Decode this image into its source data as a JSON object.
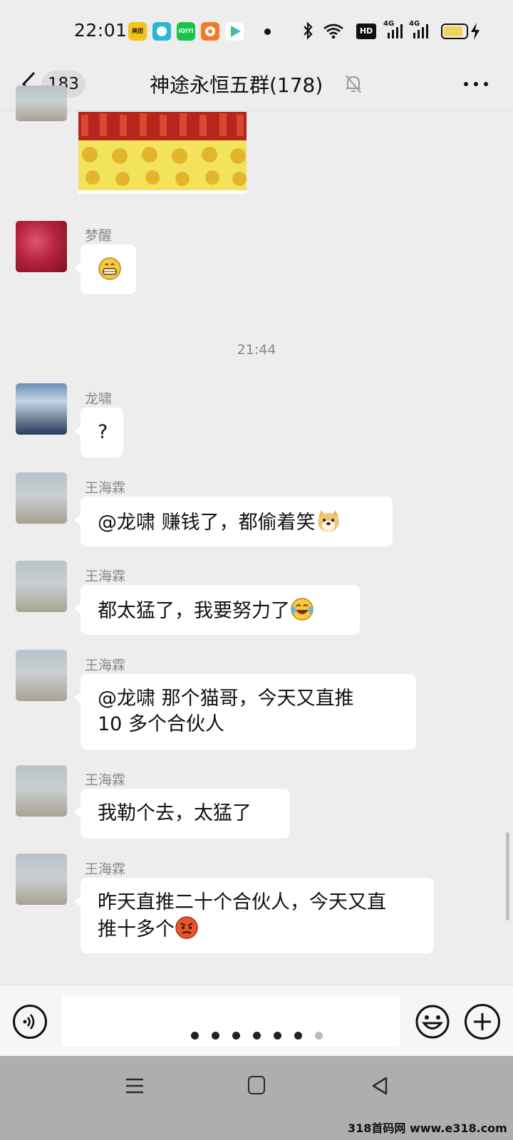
{
  "status_bar": {
    "time": "22:01",
    "apps": [
      {
        "name": "meituan-app-icon",
        "label": "美团",
        "color": "#f6c21a"
      },
      {
        "name": "app2-icon",
        "label": "",
        "color": "#2ab5d4"
      },
      {
        "name": "iqiyi-app-icon",
        "label": "iQIYI",
        "color": "#19c24a"
      },
      {
        "name": "app4-icon",
        "label": "",
        "color": "#f47a2a"
      },
      {
        "name": "app5-icon",
        "label": "",
        "color": "#3fb6e8"
      }
    ],
    "hd_label": "HD",
    "signal1_label": "4G",
    "signal2_label": "4G"
  },
  "header": {
    "unread_count": "183",
    "title": "神途永恒五群(178)"
  },
  "messages": [
    {
      "sender": "梦醒",
      "text": ""
    },
    {
      "sender": "龙啸",
      "text": "?"
    },
    {
      "sender": "王海霖",
      "text": "@龙啸  赚钱了，都偷着笑"
    },
    {
      "sender": "王海霖",
      "text": "都太猛了，我要努力了"
    },
    {
      "sender": "王海霖",
      "line1": "@龙啸  那个猫哥，今天又直推",
      "line2": "10 多个合伙人"
    },
    {
      "sender": "王海霖",
      "text": "我勒个去，太猛了"
    },
    {
      "sender": "王海霖",
      "line1": "昨天直推二十个合伙人，今天又直",
      "line2": "推十多个"
    }
  ],
  "timestamp": "21:44",
  "watermark": "318首码网 www.e318.com",
  "colors": {
    "background": "#ededed",
    "bubble": "#ffffff",
    "navbar": "#aeaeae"
  }
}
